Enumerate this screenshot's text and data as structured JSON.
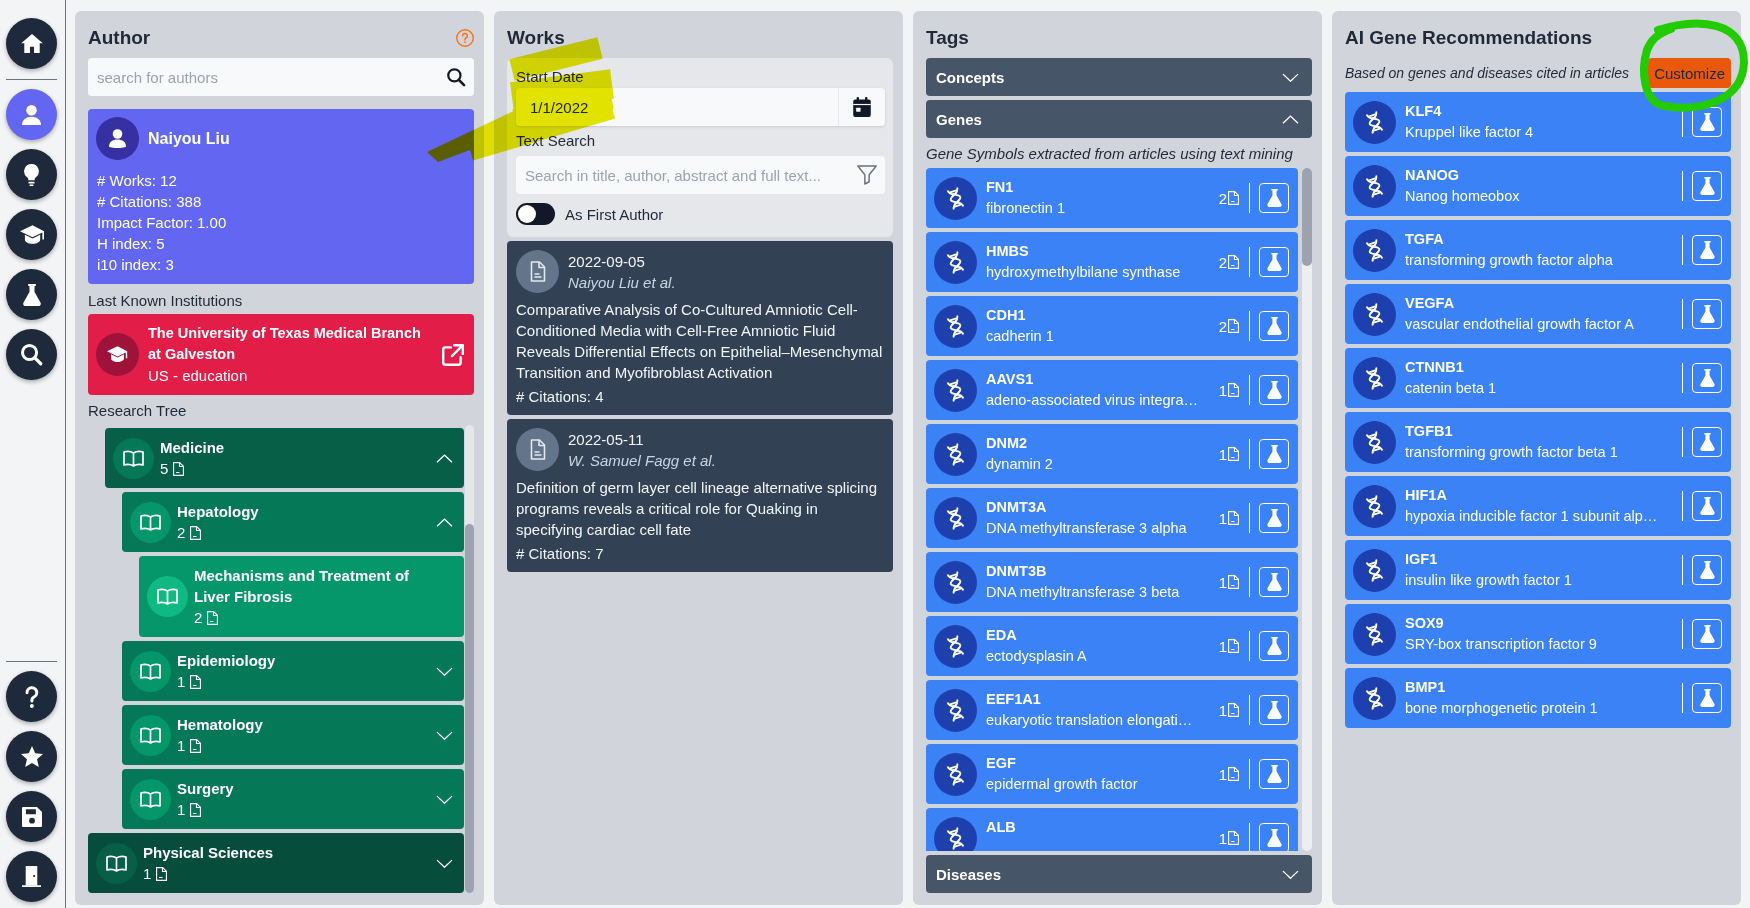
{
  "sidebar": {
    "top": [
      {
        "kind": "home",
        "selected": false
      }
    ],
    "middle": [
      {
        "kind": "person",
        "selected": true
      },
      {
        "kind": "lightbulb",
        "selected": false
      },
      {
        "kind": "graduation-cap",
        "selected": false
      },
      {
        "kind": "flask",
        "selected": false
      },
      {
        "kind": "search",
        "selected": false
      }
    ],
    "bottom": [
      {
        "kind": "help",
        "selected": false
      },
      {
        "kind": "star",
        "selected": false
      },
      {
        "kind": "save",
        "selected": false
      },
      {
        "kind": "door",
        "selected": false
      }
    ]
  },
  "author_panel": {
    "title": "Author",
    "search": {
      "placeholder": "search for authors"
    },
    "author": {
      "name": "Naiyou Liu",
      "stats": [
        "# Works: 12",
        "# Citations: 388",
        "Impact Factor: 1.00",
        "H index: 5",
        "i10 index: 3"
      ]
    },
    "institutions_label": "Last Known Institutions",
    "institutions": [
      {
        "name": "The University of Texas Medical Branch at Galveston",
        "detail": "US - education"
      }
    ],
    "tree_label": "Research Tree",
    "tree": [
      {
        "children": [
          {
            "label": "Medicine",
            "count": "5",
            "expanded": true,
            "children": [
              {
                "label": "Hepatology",
                "count": "2",
                "expanded": true,
                "children": [
                  {
                    "label": "Mechanisms and Treatment of Liver Fibrosis",
                    "count": "2"
                  }
                ]
              },
              {
                "label": "Epidemiology",
                "count": "1",
                "expanded": false
              },
              {
                "label": "Hematology",
                "count": "1",
                "expanded": false
              },
              {
                "label": "Surgery",
                "count": "1",
                "expanded": false
              }
            ]
          }
        ]
      },
      {
        "label": "Physical Sciences",
        "count": "1",
        "expanded": false
      }
    ]
  },
  "works_panel": {
    "title": "Works",
    "start_date": {
      "label": "Start Date",
      "value": "1/1/2022",
      "highlighted": true
    },
    "text_search": {
      "label": "Text Search",
      "placeholder": "Search in title, author, abstract and full text..."
    },
    "first_author": {
      "label": "As First Author",
      "on": false
    },
    "works": [
      {
        "date": "2022-09-05",
        "authors": "Naiyou Liu et al.",
        "title": "Comparative Analysis of Co-Cultured Amniotic Cell-Conditioned Media with Cell-Free Amniotic Fluid Reveals Differential Effects on Epithelial–Mesenchymal Transition and Myofibroblast Activation",
        "citations": "# Citations: 4"
      },
      {
        "date": "2022-05-11",
        "authors": "W. Samuel Fagg et al.",
        "title": "Definition of germ layer cell lineage alternative splicing programs reveals a critical role for Quaking in specifying cardiac cell fate",
        "citations": "# Citations: 7"
      }
    ]
  },
  "tags_panel": {
    "title": "Tags",
    "sections": [
      {
        "title": "Concepts",
        "expanded": false
      },
      {
        "title": "Genes",
        "expanded": true,
        "subtitle": "Gene Symbols extracted from articles using text mining",
        "genes": [
          {
            "symbol": "FN1",
            "name": "fibronectin 1",
            "count": "2"
          },
          {
            "symbol": "HMBS",
            "name": "hydroxymethylbilane synthase",
            "count": "2"
          },
          {
            "symbol": "CDH1",
            "name": "cadherin 1",
            "count": "2"
          },
          {
            "symbol": "AAVS1",
            "name": "adeno-associated virus integra…",
            "count": "1"
          },
          {
            "symbol": "DNM2",
            "name": "dynamin 2",
            "count": "1"
          },
          {
            "symbol": "DNMT3A",
            "name": "DNA methyltransferase 3 alpha",
            "count": "1"
          },
          {
            "symbol": "DNMT3B",
            "name": "DNA methyltransferase 3 beta",
            "count": "1"
          },
          {
            "symbol": "EDA",
            "name": "ectodysplasin A",
            "count": "1"
          },
          {
            "symbol": "EEF1A1",
            "name": "eukaryotic translation elongati…",
            "count": "1"
          },
          {
            "symbol": "EGF",
            "name": "epidermal growth factor",
            "count": "1"
          },
          {
            "symbol": "ALB",
            "count": "1"
          }
        ]
      },
      {
        "title": "Diseases",
        "expanded": false
      }
    ]
  },
  "recommendations_panel": {
    "title": "AI Gene Recommendations",
    "subtitle": "Based on genes and diseases cited in articles",
    "customize_button": {
      "label": "Customize",
      "circled": true
    },
    "genes": [
      {
        "symbol": "KLF4",
        "name": "Kruppel like factor 4"
      },
      {
        "symbol": "NANOG",
        "name": "Nanog homeobox"
      },
      {
        "symbol": "TGFA",
        "name": "transforming growth factor alpha"
      },
      {
        "symbol": "VEGFA",
        "name": "vascular endothelial growth factor A"
      },
      {
        "symbol": "CTNNB1",
        "name": "catenin beta 1"
      },
      {
        "symbol": "TGFB1",
        "name": "transforming growth factor beta 1"
      },
      {
        "symbol": "HIF1A",
        "name": "hypoxia inducible factor 1 subunit alp…"
      },
      {
        "symbol": "IGF1",
        "name": "insulin like growth factor 1"
      },
      {
        "symbol": "SOX9",
        "name": "SRY-box transcription factor 9"
      },
      {
        "symbol": "BMP1",
        "name": "bone morphogenetic protein 1"
      }
    ]
  }
}
